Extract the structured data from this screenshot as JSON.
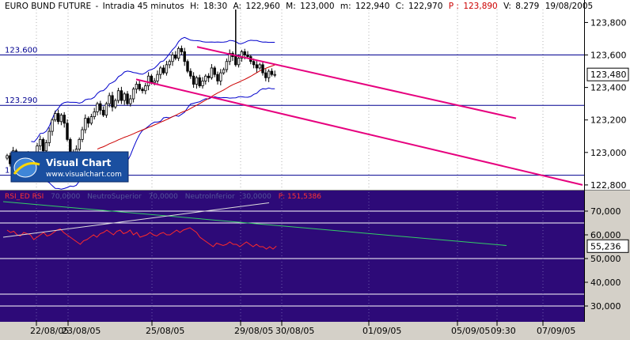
{
  "header": {
    "instrument": "EURO BUND FUTURE",
    "timeframe": "Intradia 45 minutos",
    "h_label": "H:",
    "h_value": "18:30",
    "a_label": "A:",
    "a_value": "122,960",
    "m_label": "M:",
    "m_value": "123,000",
    "min_label": "m:",
    "min_value": "122,940",
    "c_label": "C:",
    "c_value": "122,970",
    "p_label": "P :",
    "p_value": "123,890",
    "v_label": "V:",
    "v_value": "8.279",
    "date": "19/08/2005"
  },
  "logo": {
    "brand": "Visual Chart",
    "url": "www.visualchart.com"
  },
  "price_chart": {
    "ylim": [
      122780,
      123880
    ],
    "y_ticks": [
      {
        "v": 122800,
        "label": "122,800"
      },
      {
        "v": 123000,
        "label": "123,000"
      },
      {
        "v": 123200,
        "label": "123,200"
      },
      {
        "v": 123400,
        "label": "123,400"
      },
      {
        "v": 123600,
        "label": "123,600"
      },
      {
        "v": 123800,
        "label": "123,800"
      }
    ],
    "current_price": {
      "v": 123480,
      "label": "123,480"
    },
    "hlines": [
      {
        "v": 123600,
        "label": "123.600"
      },
      {
        "v": 123290,
        "label": "123.290"
      },
      {
        "v": 122860,
        "label": "1"
      }
    ],
    "colors": {
      "candle": "#000000",
      "hline": "#000090",
      "bollinger": "#0000cc",
      "ma": "#cc0000",
      "trend": "#e6007e"
    }
  },
  "rsi_panel": {
    "title": "RSI_ED  RSI",
    "faint_labels": [
      "70,0000",
      "NeutroSuperior",
      "70,0000",
      "NeutroInferior",
      "30,0000"
    ],
    "p_label": "P: 151,5386",
    "ylim": [
      24,
      78
    ],
    "y_ticks": [
      {
        "v": 70,
        "label": "70,000"
      },
      {
        "v": 60,
        "label": "60,000"
      },
      {
        "v": 50,
        "label": "50,000"
      },
      {
        "v": 40,
        "label": "40,000"
      },
      {
        "v": 30,
        "label": "30,000"
      }
    ],
    "current_value": {
      "v": 55.236,
      "label": "55,236"
    },
    "hlines": [
      70,
      65,
      50,
      35,
      30
    ],
    "colors": {
      "background": "#2d0a78",
      "rsi": "#ff2a2a",
      "trend_green": "#33cc66",
      "trend_white": "#dddddd",
      "hline": "#ffffff"
    }
  },
  "x_axis": {
    "labels": [
      "22/08/05",
      "23/08/05",
      "25/08/05",
      "29/08/05",
      "30/08/05",
      "01/09/05",
      "05/09/05",
      "09:30",
      "07/09/05"
    ]
  },
  "chart_data": {
    "type": "candlestick",
    "title": "EURO BUND FUTURE - Intradia 45 minutos",
    "categories": [
      "22/08/05",
      "23/08/05",
      "25/08/05",
      "29/08/05",
      "30/08/05",
      "01/09/05",
      "05/09/05",
      "07/09/05"
    ],
    "price_range": [
      122780,
      123880
    ],
    "closes": [
      122980,
      122930,
      123010,
      122950,
      122880,
      122960,
      122990,
      122930,
      122900,
      122960,
      123040,
      123080,
      123010,
      123060,
      123130,
      123200,
      123240,
      123190,
      123230,
      123180,
      123080,
      123000,
      122980,
      123020,
      123080,
      123140,
      123210,
      123180,
      123220,
      123250,
      123300,
      123260,
      123230,
      123300,
      123350,
      123280,
      123320,
      123380,
      123320,
      123360,
      123300,
      123330,
      123390,
      123420,
      123390,
      123380,
      123410,
      123470,
      123430,
      123440,
      123480,
      123520,
      123490,
      123540,
      123560,
      123600,
      123580,
      123640,
      123620,
      123560,
      123500,
      123470,
      123420,
      123460,
      123410,
      123440,
      123470,
      123460,
      123520,
      123480,
      123440,
      123490,
      123510,
      123560,
      123610,
      123590,
      123540,
      123580,
      123620,
      123600,
      123590,
      123560,
      123540,
      123520,
      123540,
      123490,
      123460,
      123500,
      123480,
      123480
    ],
    "series": [
      {
        "name": "RSI",
        "values": [
          62,
          61,
          61.5,
          60,
          59.5,
          61,
          60.5,
          60,
          58,
          59,
          60,
          61,
          59.5,
          60,
          61,
          62,
          62.5,
          61,
          60,
          59,
          58,
          57,
          56,
          57.5,
          58,
          59,
          60,
          59,
          60.5,
          61,
          62,
          61,
          60,
          61.5,
          62,
          60.5,
          61,
          62,
          60,
          61,
          59,
          59.5,
          60,
          61,
          60,
          59.5,
          60.5,
          61,
          60,
          60,
          61,
          62,
          61,
          62,
          62.5,
          63,
          62,
          61,
          59,
          58,
          57,
          56,
          55,
          56.5,
          56,
          55.5,
          56,
          57,
          56,
          56,
          55,
          56,
          57,
          56,
          55,
          56,
          55,
          55,
          54,
          55,
          54,
          55.236
        ]
      },
      {
        "name": "NeutroSuperior",
        "values": [
          70
        ]
      },
      {
        "name": "NeutroInferior",
        "values": [
          30
        ]
      }
    ]
  }
}
